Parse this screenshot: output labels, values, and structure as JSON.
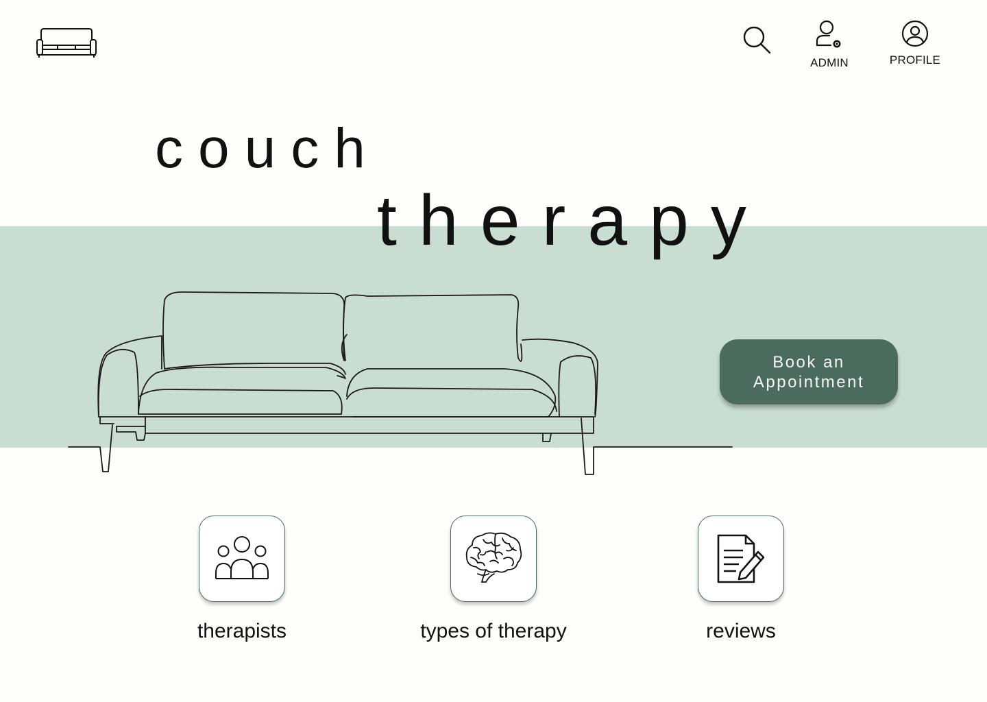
{
  "header": {
    "logo_icon": "couch-icon",
    "search_icon": "search-icon",
    "nav": [
      {
        "label": "ADMIN",
        "icon": "user-gear-icon"
      },
      {
        "label": "PROFILE",
        "icon": "user-circle-icon"
      }
    ]
  },
  "hero": {
    "title_line1": "couch",
    "title_line2": "therapy",
    "illustration": "sofa-line-drawing",
    "cta_label": "Book an Appointment",
    "band_color": "#c9ddd3",
    "cta_color": "#4b6b5e"
  },
  "features": [
    {
      "label": "therapists",
      "icon": "people-group-icon"
    },
    {
      "label": "types of therapy",
      "icon": "brain-icon"
    },
    {
      "label": "reviews",
      "icon": "document-edit-icon"
    }
  ],
  "theme": {
    "background": "#fdfdfb",
    "accent": "#4b6b5e",
    "text": "#111111"
  }
}
